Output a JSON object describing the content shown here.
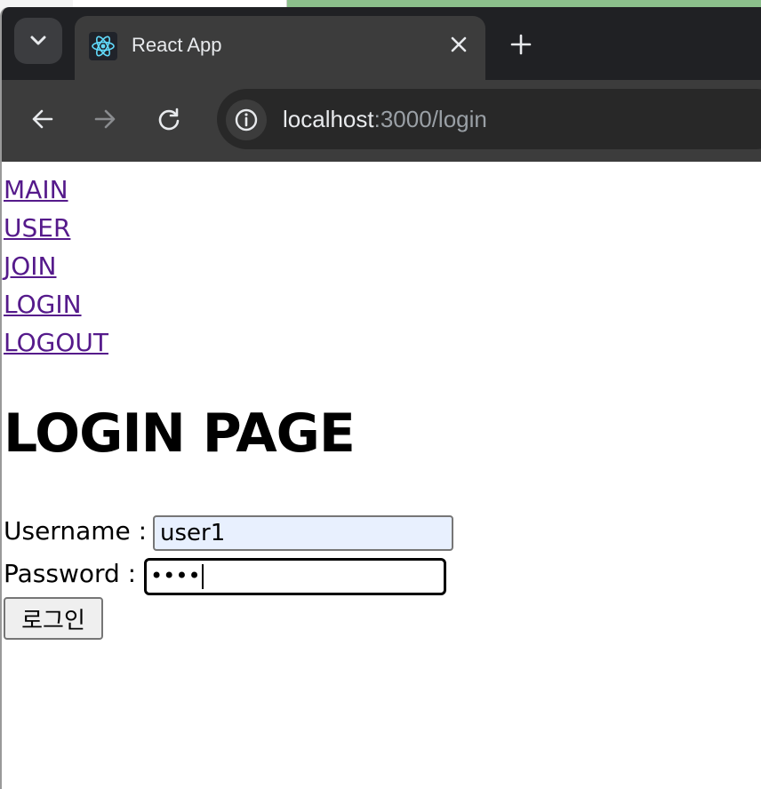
{
  "browser": {
    "tab_title": "React App",
    "url_host": "localhost",
    "url_path": ":3000/login"
  },
  "nav": {
    "links": [
      "MAIN",
      "USER",
      "JOIN",
      "LOGIN",
      "LOGOUT"
    ]
  },
  "page": {
    "title": "LOGIN PAGE",
    "username_label": "Username : ",
    "username_value": "user1",
    "password_label": "Password : ",
    "password_mask": "••••",
    "login_button": "로그인"
  },
  "icons": {
    "tab_menu": "chevron-down-icon",
    "favicon": "react-logo-icon",
    "close": "close-icon",
    "new_tab": "plus-icon",
    "back": "arrow-left-icon",
    "forward": "arrow-right-icon",
    "reload": "reload-icon",
    "site_info": "info-icon"
  },
  "colors": {
    "link_visited": "#551a8b",
    "autofill_bg": "#e8f0fe",
    "browser_dark": "#202124"
  }
}
